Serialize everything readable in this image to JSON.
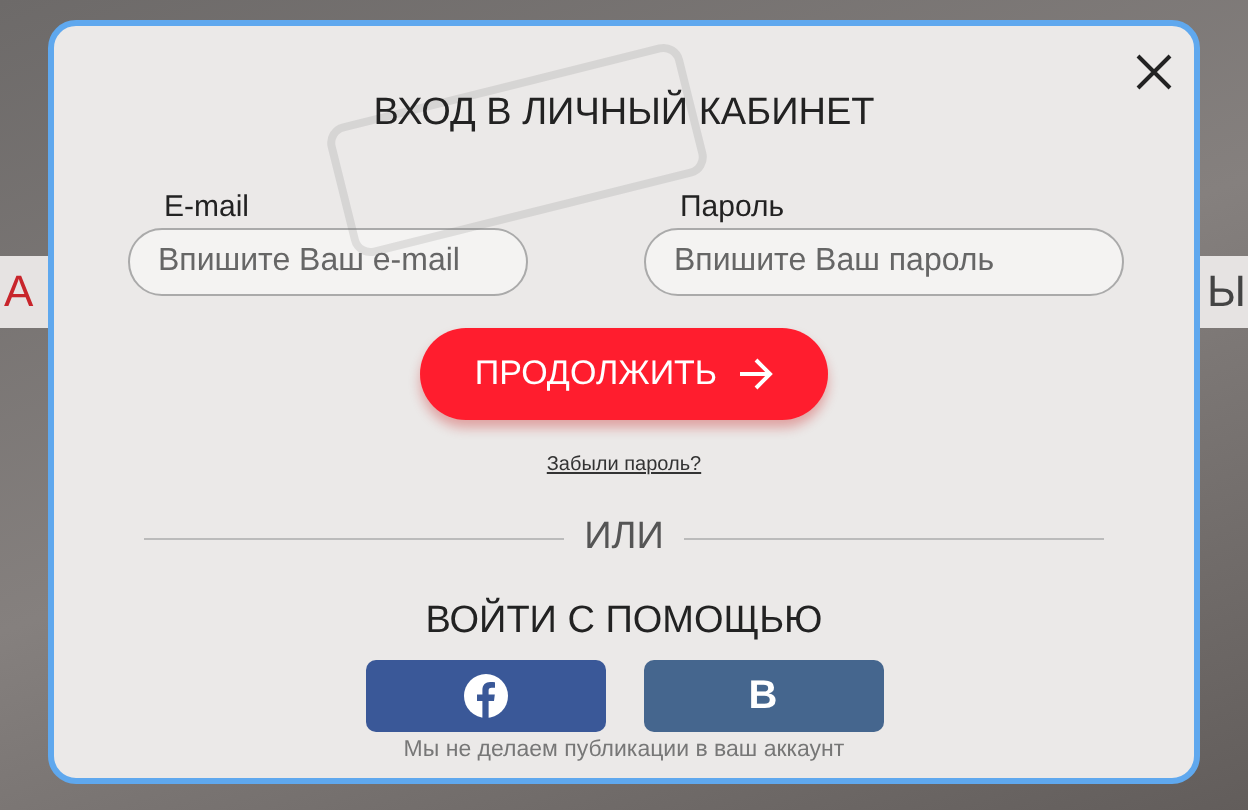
{
  "background_page": {
    "headline_left_fragment": "А",
    "headline_right_fragment": "Ы"
  },
  "modal": {
    "title": "ВХОД В ЛИЧНЫЙ КАБИНЕТ",
    "fields": [
      {
        "label": "E-mail",
        "placeholder": "Впишите Ваш e-mail",
        "kind": "email"
      },
      {
        "label": "Пароль",
        "placeholder": "Впишите Ваш пароль",
        "kind": "password"
      }
    ],
    "submit_button": "ПРОДОЛЖИТЬ",
    "forgot_link": "Забыли пароль?",
    "divider": "ИЛИ",
    "social_title": "ВОЙТИ С ПОМОЩЬЮ",
    "social_buttons": [
      {
        "kind": "facebook",
        "color": "#3a5898"
      },
      {
        "kind": "vk",
        "glyph": "В",
        "color": "#45668e"
      }
    ],
    "note": "Мы не делаем публикации в ваш аккаунт"
  }
}
